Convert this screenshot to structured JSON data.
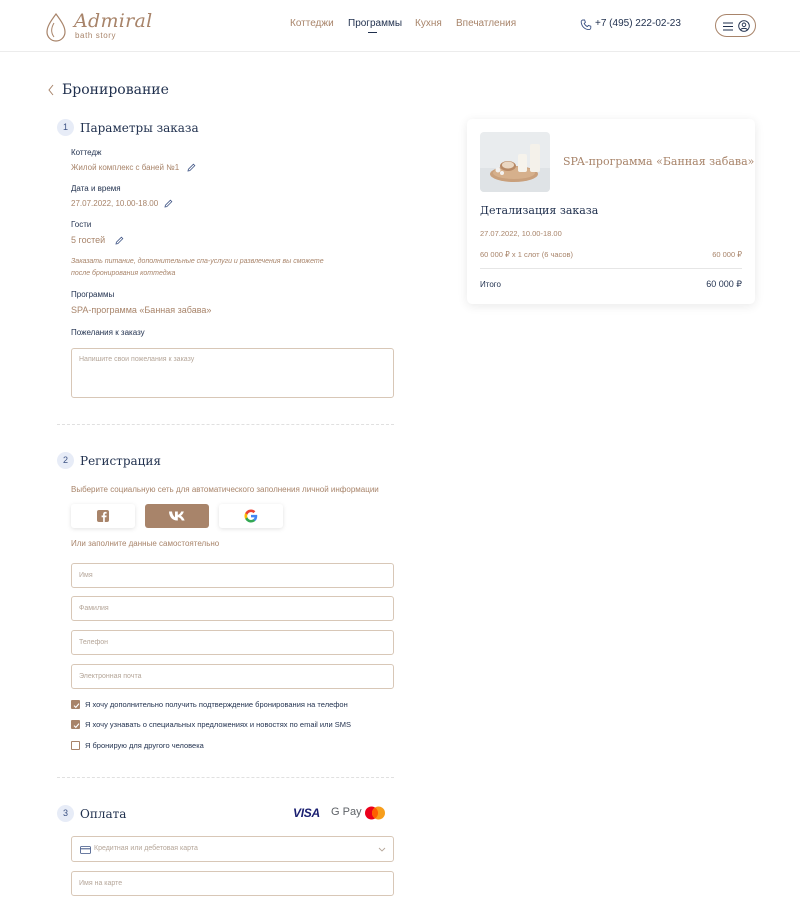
{
  "header": {
    "logo_word": "Admiral",
    "logo_sub": "bath story",
    "nav": [
      "Коттеджи",
      "Программы",
      "Кухня",
      "Впечатления"
    ],
    "active_nav": "Программы",
    "phone": "+7 (495) 222-02-23",
    "icons": [
      "phone-icon",
      "menu-icon",
      "user-icon"
    ]
  },
  "page": {
    "title": "Бронирование"
  },
  "step1": {
    "num": "1",
    "title": "Параметры заказа",
    "cottage_label": "Коттедж",
    "cottage_value": "Жилой комплекс с баней №1",
    "datetime_label": "Дата и время",
    "datetime_value": "27.07.2022, 10.00-18.00",
    "guests_label": "Гости",
    "guests_value": "5 гостей",
    "note_line1": "Заказать питание, дополнительные спа-услуги и развлечения вы сможете",
    "note_line2": "после бронирования коттеджа",
    "programs_label": "Программы",
    "programs_value": "SPA-программа «Банная забава»",
    "wishes_label": "Пожелания к заказу",
    "wishes_placeholder": "Напишите свои пожелания к заказу"
  },
  "step2": {
    "num": "2",
    "title": "Регистрация",
    "social_hint": "Выберите социальную сеть для автоматического заполнения личной информации",
    "social_buttons": [
      "facebook-icon",
      "vk-icon",
      "google-icon"
    ],
    "manual_hint": "Или заполните данные самостоятельно",
    "name_placeholder": "Имя",
    "surname_placeholder": "Фамилия",
    "phone_placeholder": "Телефон",
    "email_placeholder": "Электронная почта",
    "checkboxes": [
      {
        "label": "Я хочу дополнительно получить подтверждение бронирования на телефон",
        "checked": true
      },
      {
        "label": "Я хочу узнавать о специальных предложениях и новостях по email или SMS",
        "checked": true
      },
      {
        "label": "Я бронирую для другого человека",
        "checked": false
      }
    ]
  },
  "step3": {
    "num": "3",
    "title": "Оплата",
    "logos": {
      "visa": "VISA",
      "gpay": "G Pay"
    },
    "card_type_placeholder": "Кредитная или дебетовая карта",
    "card_name_placeholder": "Имя на карте"
  },
  "summary": {
    "program_title": "SPA-программа «Банная забава»",
    "details_title": "Детализация заказа",
    "date": "27.07.2022, 10.00-18.00",
    "line_desc": "60 000 ₽ x 1 слот (6 часов)",
    "line_price": "60 000 ₽",
    "total_label": "Итого",
    "total_value": "60 000 ₽"
  },
  "colors": {
    "accent": "#a8846a",
    "navy": "#1f2f4d",
    "step_bg": "#e7ecf7"
  }
}
